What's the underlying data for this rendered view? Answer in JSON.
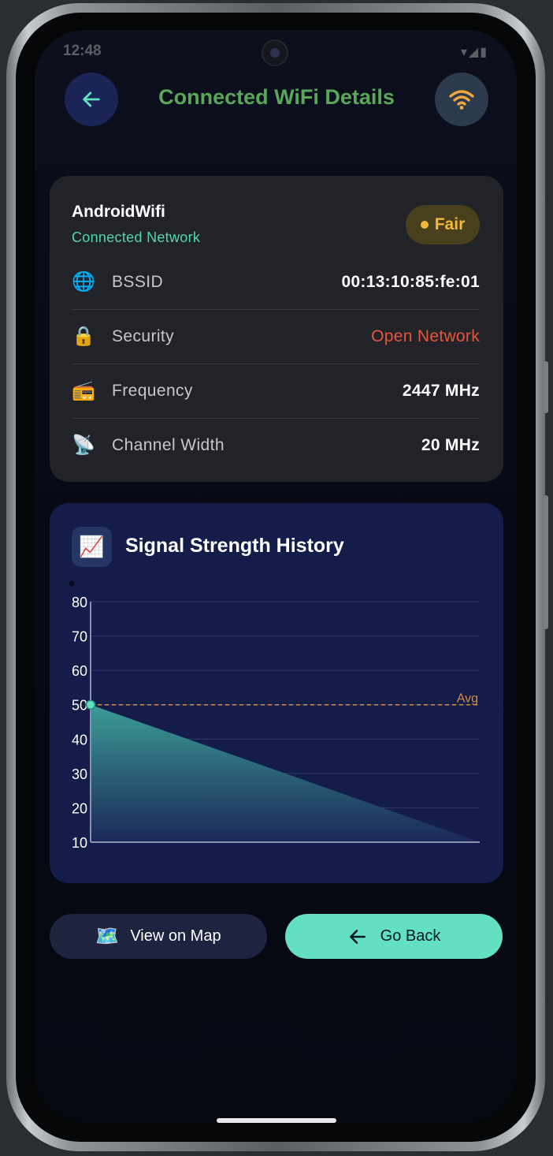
{
  "status": {
    "time": "12:48",
    "icons": "▾◢▮"
  },
  "header": {
    "title": "Connected WiFi Details",
    "back_icon": "arrow-left-icon",
    "wifi_icon": "wifi-icon"
  },
  "network": {
    "name": "AndroidWifi",
    "subtitle": "Connected Network",
    "badge": "Fair",
    "rows": [
      {
        "icon": "🌐",
        "label": "BSSID",
        "value": "00:13:10:85:fe:01"
      },
      {
        "icon": "🔒",
        "label": "Security",
        "value": "Open Network"
      },
      {
        "icon": "📻",
        "label": "Frequency",
        "value": "2447 MHz"
      },
      {
        "icon": "📡",
        "label": "Channel Width",
        "value": "20 MHz"
      }
    ]
  },
  "chart_card": {
    "icon": "📈",
    "title": "Signal Strength History"
  },
  "chart_data": {
    "type": "area",
    "title": "Signal Strength History",
    "x": [
      0,
      1
    ],
    "values": [
      50,
      10
    ],
    "ylim": [
      10,
      80
    ],
    "yticks": [
      80,
      70,
      60,
      50,
      40,
      30,
      20,
      10
    ],
    "avg": {
      "label": "Avg",
      "value": 50
    },
    "grid": true,
    "colors": {
      "area_top": "#3ea39a",
      "area_bottom": "#1b2a5a",
      "avg_line": "#d98a3b",
      "point": "#63e0c2",
      "grid": "#2e3870",
      "axis": "#8a90b0"
    }
  },
  "buttons": {
    "map_icon": "🗺️",
    "map_label": "View on Map",
    "back_label": "Go Back"
  },
  "colors": {
    "accent": "#63e0c2",
    "title": "#59a85a",
    "badge": "#f4b93c",
    "danger": "#e8553f"
  }
}
